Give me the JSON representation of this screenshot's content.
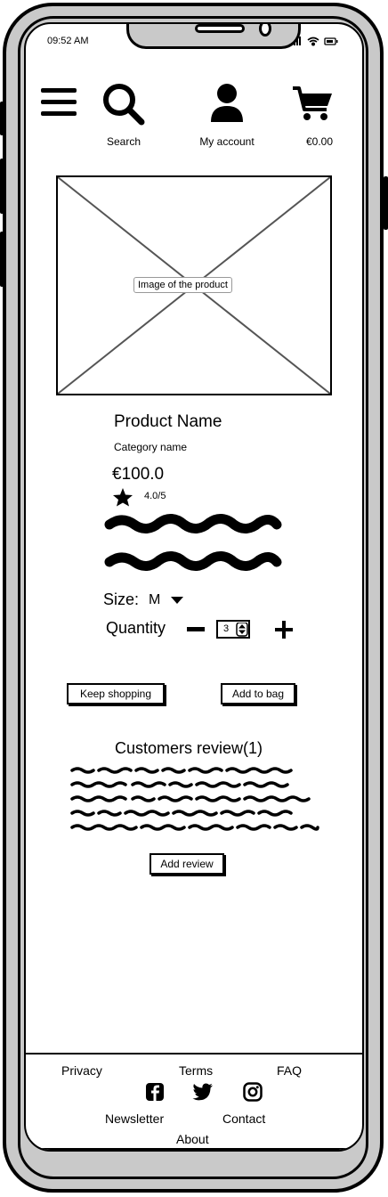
{
  "status_bar": {
    "time": "09:52 AM"
  },
  "header": {
    "search_label": "Search",
    "account_label": "My account",
    "cart_total": "€0.00"
  },
  "product": {
    "image_caption": "Image of the product",
    "name": "Product Name",
    "category": "Category name",
    "price": "€100.0",
    "rating": "4.0/5"
  },
  "options": {
    "size_label": "Size:",
    "size_value": "M",
    "quantity_label": "Quantity",
    "quantity_value": "3"
  },
  "actions": {
    "keep_shopping": "Keep shopping",
    "add_to_bag": "Add to bag"
  },
  "reviews": {
    "title": "Customers review(1)",
    "add_review": "Add review"
  },
  "footer": {
    "privacy": "Privacy",
    "terms": "Terms",
    "faq": "FAQ",
    "newsletter": "Newsletter",
    "contact": "Contact",
    "about": "About"
  },
  "icons": {
    "menu": "hamburger-menu-icon",
    "search": "search-icon",
    "account": "user-icon",
    "cart": "cart-icon",
    "star": "star-icon",
    "facebook": "facebook-icon",
    "twitter": "twitter-icon",
    "instagram": "instagram-icon"
  }
}
